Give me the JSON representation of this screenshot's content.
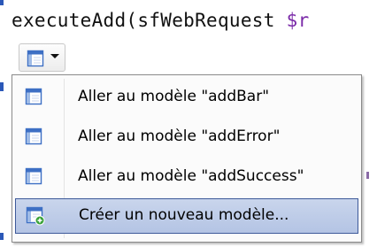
{
  "code": {
    "function_text": "executeAdd(sfWebRequest ",
    "variable_text": "$r"
  },
  "smart_tag": {
    "icon": "template-icon",
    "dropdown_icon": "chevron-down-icon"
  },
  "menu": {
    "items": [
      {
        "label": "Aller au modèle \"addBar\"",
        "icon": "template-icon"
      },
      {
        "label": "Aller au modèle \"addError\"",
        "icon": "template-icon"
      },
      {
        "label": "Aller au modèle \"addSuccess\"",
        "icon": "template-icon"
      },
      {
        "label": "Créer un nouveau modèle...",
        "icon": "new-template-icon",
        "selected": true
      }
    ]
  },
  "colors": {
    "selection_fill": "#b4c4e4",
    "selection_border": "#3e5a9a",
    "icon_blue": "#3d6fc4",
    "new_badge_green": "#3aa23a",
    "variable_purple": "#7a2aa8"
  }
}
